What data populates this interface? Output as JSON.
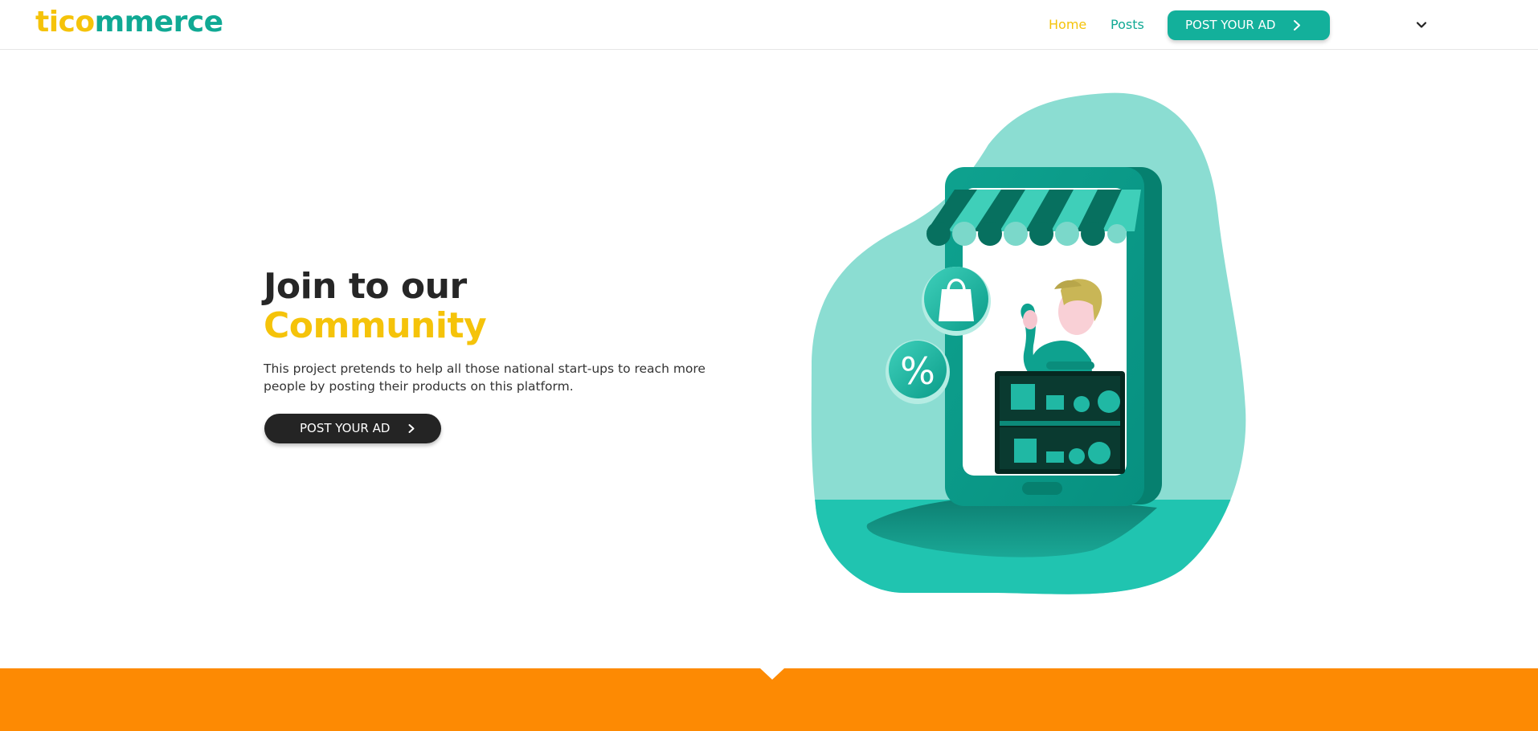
{
  "header": {
    "logo_part1": "tico",
    "logo_part2": "mmerce",
    "nav": {
      "home": "Home",
      "posts": "Posts"
    },
    "post_ad_label": "POST YOUR AD"
  },
  "hero": {
    "title_line1": "Join to our",
    "title_line2": "Community",
    "description": "This project pretends to help all those national start-ups to reach more people by posting their products on this platform.",
    "cta_label": "POST YOUR AD"
  },
  "colors": {
    "brand_yellow": "#f5c30a",
    "brand_teal": "#10a994",
    "button_teal": "#13b09b",
    "button_dark": "#242424",
    "band_orange": "#fd8a03"
  },
  "icons": {
    "header_button": "chevron-right-icon",
    "hero_button": "chevron-right-icon",
    "user_menu": "chevron-down-icon"
  }
}
